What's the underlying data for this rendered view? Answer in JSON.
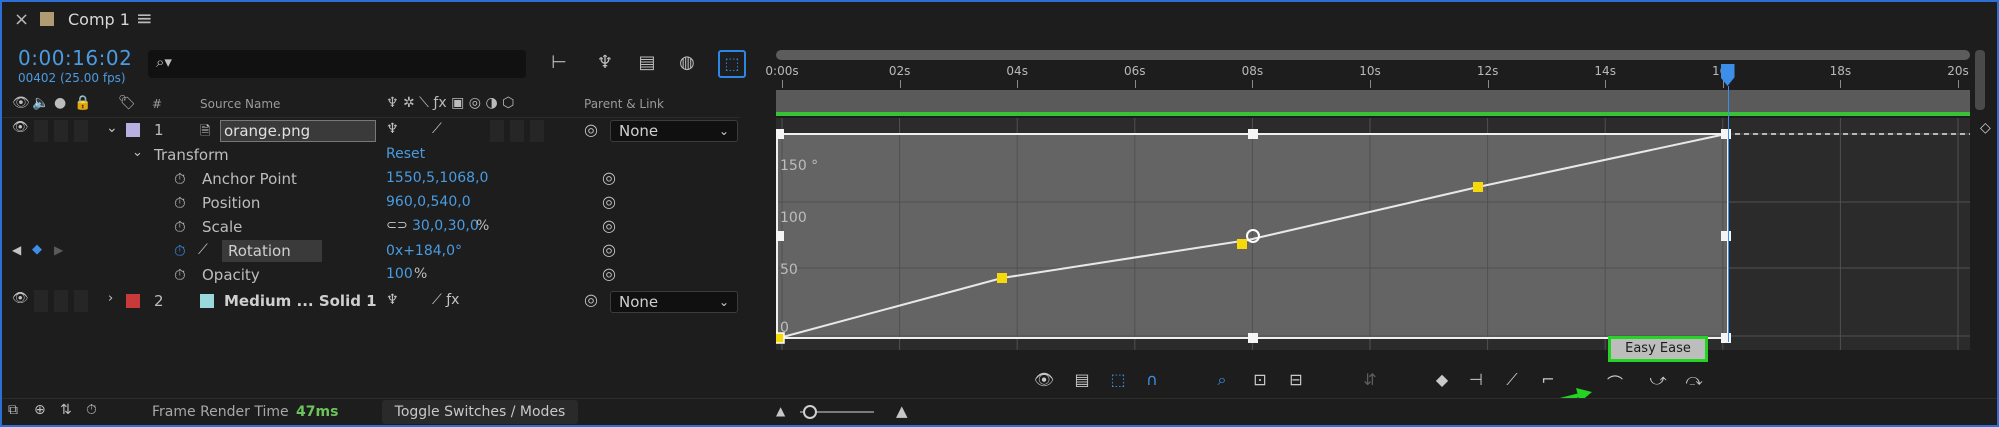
{
  "tab": {
    "close": "×",
    "title": "Comp 1",
    "menu": "≡"
  },
  "header": {
    "timecode": "0:00:16:02",
    "frame_info": "00402 (25.00 fps)",
    "search_placeholder": ""
  },
  "columns": {
    "source_name": "Source Name",
    "parent_link": "Parent & Link",
    "hash": "#"
  },
  "layers": [
    {
      "number": "1",
      "name": "orange.png",
      "color": "#b8b0e0",
      "parent": "None",
      "transform_label": "Transform",
      "reset_label": "Reset",
      "properties": [
        {
          "name": "Anchor Point",
          "value": "1550,5,1068,0"
        },
        {
          "name": "Position",
          "value": "960,0,540,0"
        },
        {
          "name": "Scale",
          "value": "30,0,30,0",
          "unit": "%"
        },
        {
          "name": "Rotation",
          "value": "0x+184,0°"
        },
        {
          "name": "Opacity",
          "value": "100",
          "unit": "%"
        }
      ]
    },
    {
      "number": "2",
      "name": "Medium ... Solid 1",
      "color": "#c83a3a",
      "swatch": "#9ad8dc",
      "parent": "None"
    }
  ],
  "bottom": {
    "frame_render_label": "Frame Render Time",
    "frame_render_value": "47ms",
    "toggle_label": "Toggle Switches / Modes"
  },
  "timeline": {
    "ticks": [
      "0:00s",
      "02s",
      "04s",
      "06s",
      "08s",
      "10s",
      "12s",
      "14s",
      "16s",
      "18s",
      "20s"
    ],
    "playhead_seconds": 16.08
  },
  "graph": {
    "y_labels": [
      "150 °",
      "100",
      "50",
      "0"
    ],
    "easy_ease_tooltip": "Easy Ease"
  },
  "colors": {
    "accent_blue": "#4b9be0",
    "highlight_green": "#23d423",
    "work_area_green": "#38c238",
    "keyframe_yellow": "#f5d90a"
  }
}
